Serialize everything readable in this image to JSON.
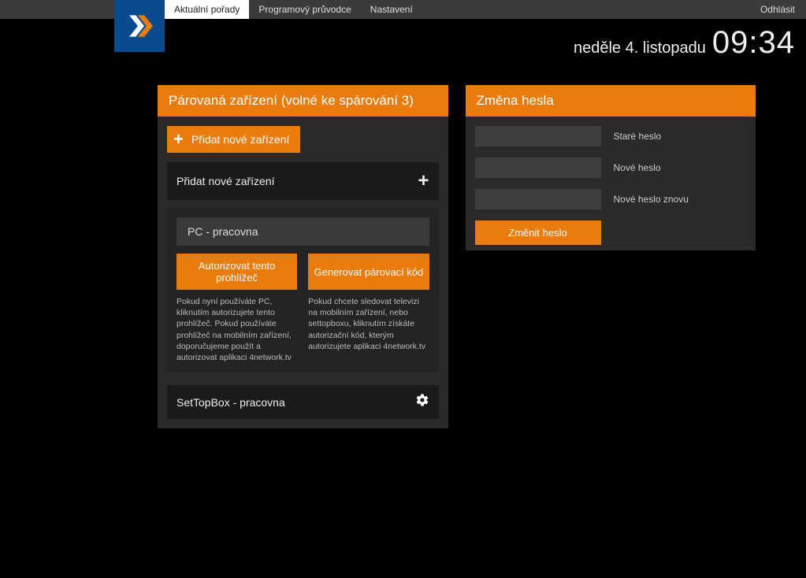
{
  "nav": {
    "items": [
      {
        "label": "Aktuální pořady",
        "active": true
      },
      {
        "label": "Programový průvodce",
        "active": false
      },
      {
        "label": "Nastavení",
        "active": false
      }
    ],
    "logout": "Odhlásit"
  },
  "datetime": {
    "date": "neděle 4. listopadu",
    "time": "09:34"
  },
  "paired": {
    "title": "Párovaná zařízení (volné ke spárování 3)",
    "add_button": "Přidat nové zařízení",
    "add_row": "Přidat nové zařízení",
    "device_name": "PC - pracovna",
    "authorize_btn": "Autorizovat tento prohlížeč",
    "generate_btn": "Generovat párovací kód",
    "authorize_desc": "Pokud nyní používáte PC, kliknutím autorizujete tento prohlížeč. Pokud používáte prohlížeč na mobilním zařízení, doporučujeme použít a autorizovat aplikaci 4network.tv",
    "generate_desc": "Pokud chcete sledovat televizi na mobilním zařízení, nebo settopboxu, kliknutím získáte autorizační kód, kterým autorizujete aplikaci 4network.tv",
    "stb_row": "SetTopBox - pracovna"
  },
  "password": {
    "title": "Změna hesla",
    "old_label": "Staré heslo",
    "new_label": "Nové heslo",
    "again_label": "Nové heslo znovu",
    "change_btn": "Změnit heslo"
  }
}
